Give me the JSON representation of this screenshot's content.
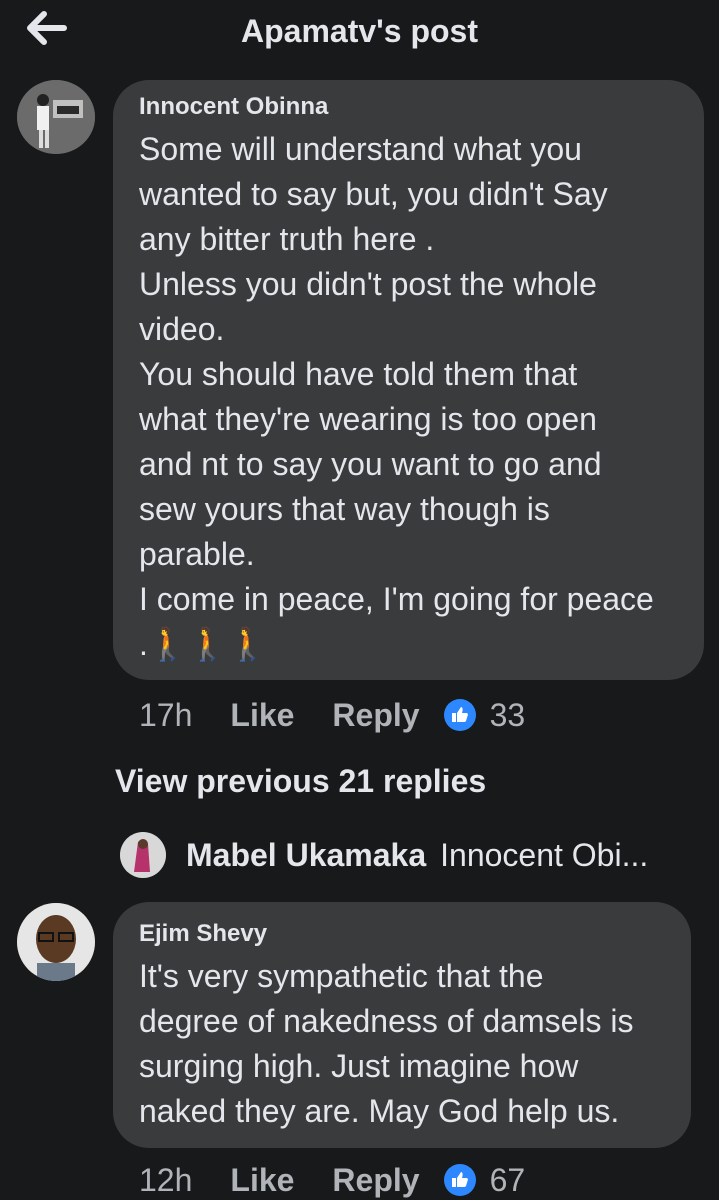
{
  "header": {
    "title": "Apamatv's post",
    "back_icon": "arrow-left-icon"
  },
  "comments": [
    {
      "author": "Innocent Obinna",
      "text": "Some will understand what you\nwanted to say but, you didn't Say\nany bitter truth here .\nUnless you didn't post the whole\nvideo.\nYou should have told them that\nwhat they're wearing is too open\nand nt to say you want to go and\nsew yours that way though is\nparable.\nI come in peace, I'm going for peace\n.🚶🚶🚶",
      "time": "17h",
      "like_label": "Like",
      "reply_label": "Reply",
      "reaction_count": "33"
    },
    {
      "author": "Ejim Shevy",
      "text": "It's very sympathetic that the\ndegree of nakedness of damsels is\nsurging high. Just imagine how\nnaked they are. May God help us.",
      "time": "12h",
      "like_label": "Like",
      "reply_label": "Reply",
      "reaction_count": "67"
    }
  ],
  "view_previous": "View previous 21 replies",
  "reply_preview": {
    "name": "Mabel Ukamaka",
    "snippet": "Innocent Obi..."
  },
  "colors": {
    "background": "#18191a",
    "bubble": "#3a3b3c",
    "accent": "#2d88ff",
    "secondary_text": "#b0b3b8"
  }
}
